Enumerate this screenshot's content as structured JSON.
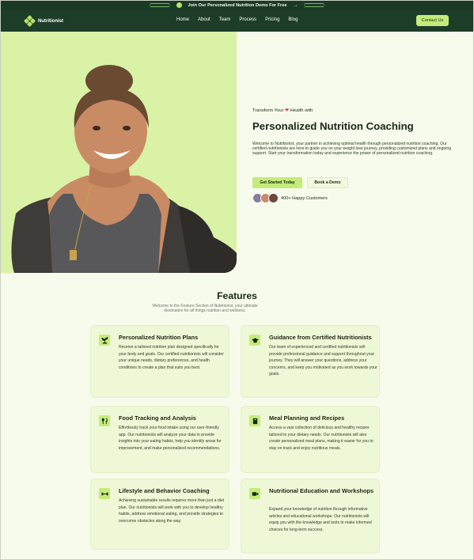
{
  "announcement": {
    "text": "Join Our Personalized Nutrition Demo For Free",
    "arrow": "→"
  },
  "brand": {
    "name": "Nutritionist"
  },
  "nav": {
    "items": [
      "Home",
      "About",
      "Team",
      "Process",
      "Pricing",
      "Blog"
    ],
    "cta": "Contact Us"
  },
  "hero": {
    "eyebrow_pre": "Transform Your",
    "eyebrow_heart": "❤",
    "eyebrow_post": "Health with",
    "title": "Personalized Nutrition Coaching",
    "description": "Welcome to Nutritionist, your partner in achieving optimal health through personalized nutrition coaching. Our certified nutritionists are here to guide you on your weight loss journey, providing customized plans and ongoing support. Start your transformation today and experience the power of personalized nutrition coaching.",
    "primary_cta": "Get Started Today",
    "secondary_cta": "Book a Demo",
    "customers": "400+ Happy Customers"
  },
  "features": {
    "title": "Features",
    "subtitle": "Welcome to the Feature Section of Nutritionist, your ultimate destination for all things nutrition and wellness.",
    "cards": [
      {
        "title": "Personalized Nutrition Plans",
        "desc": "Receive a tailored nutrition plan designed specifically for your body and goals. Our certified nutritionists will consider your unique needs, dietary preferences, and health conditions to create a plan that suits you best.",
        "icon": "plant-icon"
      },
      {
        "title": "Guidance from Certified Nutritionists",
        "desc": "Our team of experienced and certified nutritionists will provide professional guidance and support throughout your journey. They will answer your questions, address your concerns, and keep you motivated as you work towards your goals.",
        "icon": "graduation-cap-icon"
      },
      {
        "title": "Food Tracking and Analysis",
        "desc": "Effortlessly track your food intake using our user-friendly app. Our nutritionists will analyze your data to provide insights into your eating habits, help you identify areas for improvement, and make personalized recommendations.",
        "icon": "fork-knife-icon"
      },
      {
        "title": "Meal Planning and Recipes",
        "desc": "Access a vast collection of delicious and healthy recipes tailored to your dietary needs. Our nutritionists will also create personalized meal plans, making it easier for you to stay on track and enjoy nutritious meals.",
        "icon": "recipe-book-icon"
      },
      {
        "title": "Lifestyle and Behavior Coaching",
        "desc": "Achieving sustainable results requires more than just a diet plan. Our nutritionists will work with you to develop healthy habits, address emotional eating, and provide strategies to overcome obstacles along the way.",
        "icon": "dumbbell-icon"
      },
      {
        "title": "Nutritional Education and Workshops",
        "desc": "Expand your knowledge of nutrition through informative articles and educational workshops. Our nutritionists will equip you with the knowledge and tools to make informed choices for long-term success.",
        "icon": "video-icon"
      }
    ]
  },
  "colors": {
    "dark_green": "#1e3d28",
    "accent_lime": "#c4ec7a",
    "hero_bg": "#d9f2a6",
    "page_bg": "#f6fbec",
    "card_bg": "#eef7d6"
  }
}
